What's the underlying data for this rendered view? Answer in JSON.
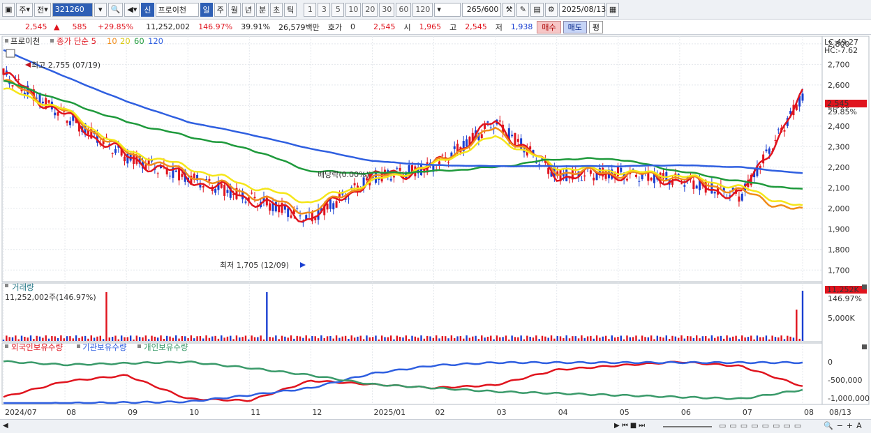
{
  "toolbar": {
    "period_day": "주",
    "prev": "전",
    "code": "321260",
    "new_badge": "신",
    "name": "프로이천",
    "periods": [
      "일",
      "주",
      "월",
      "년",
      "분",
      "초",
      "틱"
    ],
    "numbers": [
      "1",
      "3",
      "5",
      "10",
      "20",
      "30",
      "60",
      "120"
    ],
    "count": "265",
    "count_total": "/600",
    "date": "2025/08/13"
  },
  "quote": {
    "price": "2,545",
    "change": "585",
    "change_pct": "+29.85%",
    "volume": "11,252,002",
    "vol_ratio": "146.97%",
    "turnover": "39.91%",
    "amount": "26,579백만",
    "hoga_label": "호가",
    "hoga": "0",
    "hoga_price": "2,545",
    "open_label": "시",
    "open": "1,965",
    "high_label": "고",
    "high": "2,545",
    "low_label": "저",
    "low": "1,938",
    "buy": "매수",
    "sell": "매도",
    "eval": "평"
  },
  "price_panel": {
    "legend_name": "프로이천",
    "legend_ma": "종가 단순 5",
    "legend_ma_periods": [
      "10",
      "20",
      "60",
      "120"
    ],
    "lc": "LC:49.27",
    "hc": "HC:-7.62",
    "high_annot": "최고 2,755 (07/19)",
    "low_annot": "최저 1,705 (12/09)",
    "dividend": "배당락(0.00%)",
    "cur_price": "2,545",
    "cur_pct": "29.85%",
    "y_ticks": [
      "2,800",
      "2,700",
      "2,600",
      "2,500",
      "2,400",
      "2,300",
      "2,200",
      "2,100",
      "2,000",
      "1,900",
      "1,800",
      "1,700"
    ]
  },
  "volume_panel": {
    "title": "거래량",
    "info": "11,252,002주(146.97%)",
    "cur": "11,252K",
    "cur_pct": "146.97%",
    "y_tick": "5,000K"
  },
  "holding_panel": {
    "legend": [
      "외국인보유수량",
      "기관보유수량",
      "개인보유수량"
    ],
    "y_ticks": [
      "0",
      "-500,000",
      "-1,000,000"
    ]
  },
  "x_axis": [
    "2024/07",
    "08",
    "09",
    "10",
    "11",
    "12",
    "2025/01",
    "02",
    "03",
    "04",
    "05",
    "06",
    "07",
    "08",
    "08/13"
  ],
  "colors": {
    "ma5": "#e0141e",
    "ma10": "#f08c1a",
    "ma20": "#f5e61a",
    "ma60": "#1f9a3c",
    "ma120": "#2f5fe0",
    "up": "#e0141e",
    "down": "#1a3fd1",
    "foreign": "#e0141e",
    "institution": "#2f5fe0",
    "individual": "#3a9a6a"
  },
  "chart_data": {
    "type": "line",
    "x": [
      "2024/07",
      "08",
      "09",
      "10",
      "11",
      "12",
      "2025/01",
      "02",
      "03",
      "04",
      "05",
      "06",
      "07",
      "08"
    ],
    "series": [
      {
        "name": "5",
        "values": [
          2650,
          2450,
          2250,
          2150,
          2050,
          1950,
          2150,
          2200,
          2420,
          2160,
          2170,
          2140,
          2060,
          2545
        ]
      },
      {
        "name": "10",
        "values": [
          2620,
          2470,
          2270,
          2170,
          2070,
          1980,
          2140,
          2210,
          2390,
          2180,
          2170,
          2150,
          2080,
          1980
        ]
      },
      {
        "name": "20",
        "values": [
          2580,
          2480,
          2280,
          2200,
          2110,
          2030,
          2130,
          2210,
          2350,
          2200,
          2180,
          2160,
          2100,
          2000
        ]
      },
      {
        "name": "60",
        "values": [
          2620,
          2520,
          2420,
          2350,
          2290,
          2180,
          2170,
          2180,
          2200,
          2240,
          2240,
          2180,
          2130,
          2090
        ]
      },
      {
        "name": "120",
        "values": [
          2770,
          2640,
          2520,
          2420,
          2360,
          2290,
          2230,
          2210,
          2205,
          2205,
          2205,
          2210,
          2200,
          2170
        ]
      }
    ],
    "high": 2755,
    "low": 1705,
    "ylim": [
      1650,
      2830
    ]
  }
}
